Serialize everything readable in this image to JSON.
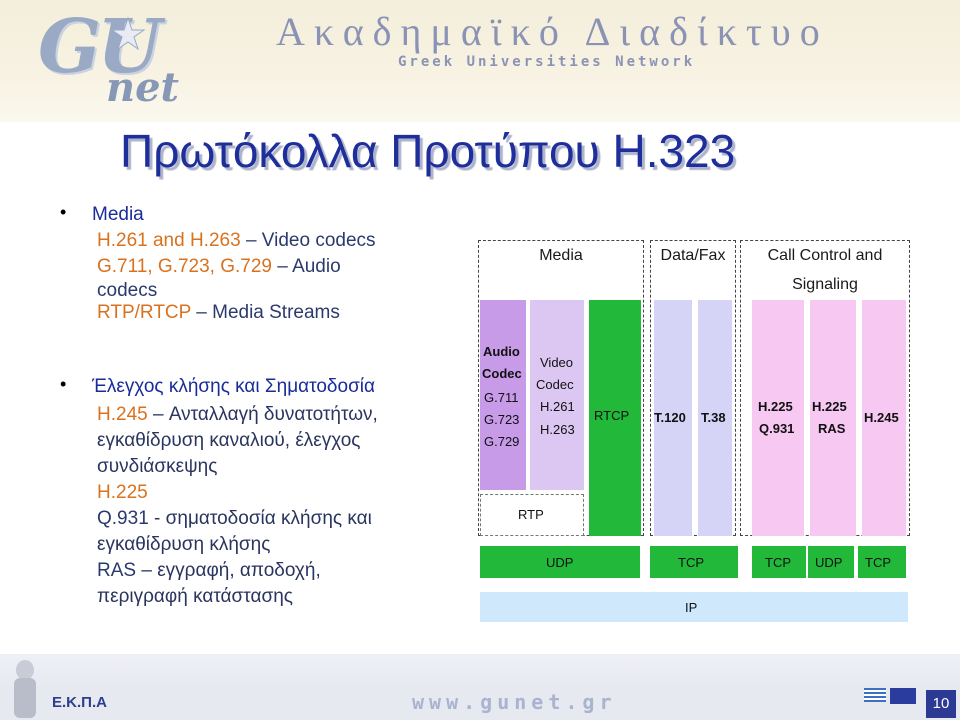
{
  "header": {
    "logo_main": "GU",
    "logo_sub": "net",
    "title": "Ακαδημαϊκό Διαδίκτυο",
    "subtitle": "Greek Universities Network"
  },
  "slide": {
    "title": "Πρωτόκολλα Προτύπου H.323"
  },
  "bullets": {
    "media_head": "Media",
    "media_line1_code": "H.261 and H.263",
    "media_line1_text": "– Video codecs",
    "media_line2_code": "G.711, G.723, G.729",
    "media_line2_text": "– Audio",
    "media_line3": "codecs",
    "media_line4_code": "RTP/RTCP",
    "media_line4_text": "– Media Streams",
    "call_head": "Έλεγχος κλήσης και Σηματοδοσία",
    "call_l1_code": "H.245",
    "call_l1_text": "– Ανταλλαγή δυνατοτήτων,",
    "call_l2": "εγκαθίδρυση καναλιού, έλεγχος",
    "call_l3": "συνδιάσκεψης",
    "call_l4_code": "H.225",
    "call_l5_code": "Q.931",
    "call_l5_text": "- σηματοδοσία κλήσης και",
    "call_l6": "εγκαθίδρυση κλήσης",
    "call_l7_code": "RAS",
    "call_l7_text": "– εγγραφή, αποδοχή,",
    "call_l8": "περιγραφή κατάστασης"
  },
  "diagram": {
    "col_media": "Media",
    "col_datafax": "Data/Fax",
    "col_call_1": "Call Control and",
    "col_call_2": "Signaling",
    "audio_codec_1": "Audio",
    "audio_codec_2": "Codec",
    "audio_g711": "G.711",
    "audio_g723": "G.723",
    "audio_g729": "G.729",
    "video_codec_1": "Video",
    "video_codec_2": "Codec",
    "video_h261": "H.261",
    "video_h263": "H.263",
    "rtcp": "RTCP",
    "rtp": "RTP",
    "t120": "T.120",
    "t38": "T.38",
    "h225_q931_a": "H.225",
    "h225_q931_b": "Q.931",
    "h225_ras_a": "H.225",
    "h225_ras_b": "RAS",
    "h245": "H.245",
    "udp_media": "UDP",
    "tcp_data": "TCP",
    "tcp_call1": "TCP",
    "udp_call": "UDP",
    "tcp_call2": "TCP",
    "ip": "IP"
  },
  "footer": {
    "org": "Ε.Κ.Π.Α",
    "url": "www.gunet.gr",
    "page": "10"
  },
  "colors": {
    "title_blue": "#1e2e9a",
    "code_orange": "#d9721f",
    "audio_purple": "#c79be8",
    "video_purple": "#dcc7f2",
    "green": "#22b83a",
    "lavender": "#d5d4f7",
    "pink": "#f7c9f2",
    "light_blue": "#cfe8fb",
    "footer_blue": "#2c3a94"
  }
}
